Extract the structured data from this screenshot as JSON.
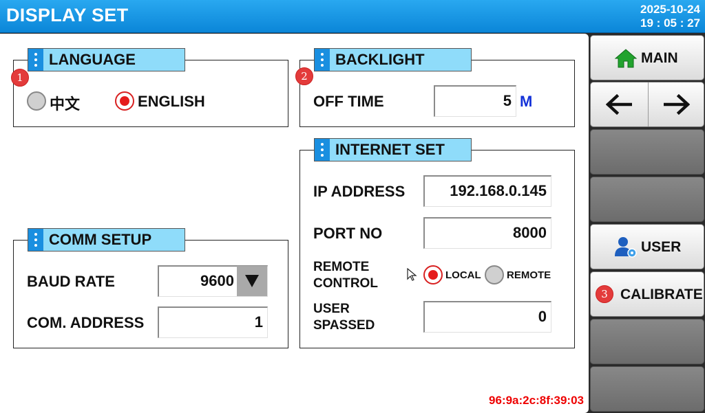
{
  "header": {
    "title": "DISPLAY SET",
    "date": "2025-10-24",
    "time": "19 : 05 : 27"
  },
  "language": {
    "title": "LANGUAGE",
    "badge": "1",
    "options": [
      {
        "label": "中文",
        "selected": false
      },
      {
        "label": "ENGLISH",
        "selected": true
      }
    ]
  },
  "backlight": {
    "title": "BACKLIGHT",
    "badge": "2",
    "off_time_label": "OFF TIME",
    "off_time_value": "5",
    "off_time_unit": "M"
  },
  "comm": {
    "title": "COMM SETUP",
    "baud_label": "BAUD RATE",
    "baud_value": "9600",
    "address_label": "COM. ADDRESS",
    "address_value": "1"
  },
  "internet": {
    "title": "INTERNET SET",
    "ip_label": "IP ADDRESS",
    "ip_value": "192.168.0.145",
    "port_label": "PORT NO",
    "port_value": "8000",
    "remote_label_1": "REMOTE",
    "remote_label_2": "CONTROL",
    "remote_options": [
      {
        "label": "LOCAL",
        "selected": true
      },
      {
        "label": "REMOTE",
        "selected": false
      }
    ],
    "user_label_1": "USER",
    "user_label_2": "SPASSED",
    "user_value": "0"
  },
  "mac": "96:9a:2c:8f:39:03",
  "sidebar": {
    "main_label": "MAIN",
    "user_label": "USER",
    "calibrate_label": "CALIBRATE",
    "calibrate_badge": "3"
  },
  "colors": {
    "header": "#0b86d8",
    "legend": "#8fdcfa",
    "accent_red": "#e51c1c",
    "unit_blue": "#1432d8"
  }
}
